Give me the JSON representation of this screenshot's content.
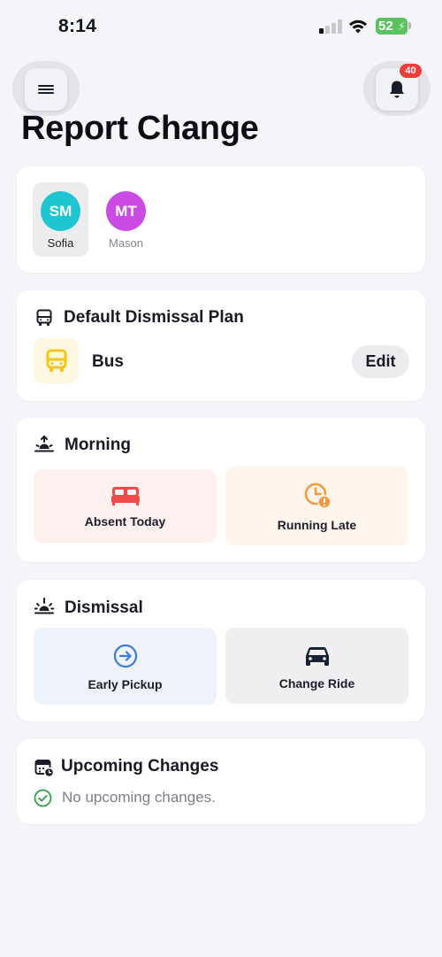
{
  "status_bar": {
    "time": "8:14",
    "battery": "52"
  },
  "header": {
    "title": "Report Change",
    "notification_count": "40",
    "menu_icon": "hamburger-icon",
    "bell_icon": "bell-icon"
  },
  "students": [
    {
      "initials": "SM",
      "name": "Sofia",
      "color": "#1ec6d2",
      "selected": true
    },
    {
      "initials": "MT",
      "name": "Mason",
      "color": "#c94be4",
      "selected": false
    }
  ],
  "default_plan": {
    "title": "Default Dismissal Plan",
    "mode": "Bus",
    "edit_label": "Edit",
    "bus_color": "#f5c518"
  },
  "morning": {
    "title": "Morning",
    "options": [
      {
        "label": "Absent Today",
        "icon": "bed-icon",
        "bg": "#fff0f0",
        "color": "#ef4b4b"
      },
      {
        "label": "Running Late",
        "icon": "clock-alert-icon",
        "bg": "#fff5ec",
        "color": "#f59a3c"
      }
    ]
  },
  "dismissal": {
    "title": "Dismissal",
    "options": [
      {
        "label": "Early Pickup",
        "icon": "arrow-circle-right-icon",
        "bg": "#eef3fa",
        "color": "#3a7bd5"
      },
      {
        "label": "Change Ride",
        "icon": "car-icon",
        "bg": "#efeff2",
        "color": "#1a2033"
      }
    ]
  },
  "upcoming": {
    "title": "Upcoming Changes",
    "empty_text": "No upcoming changes.",
    "check_color": "#2ea043"
  }
}
